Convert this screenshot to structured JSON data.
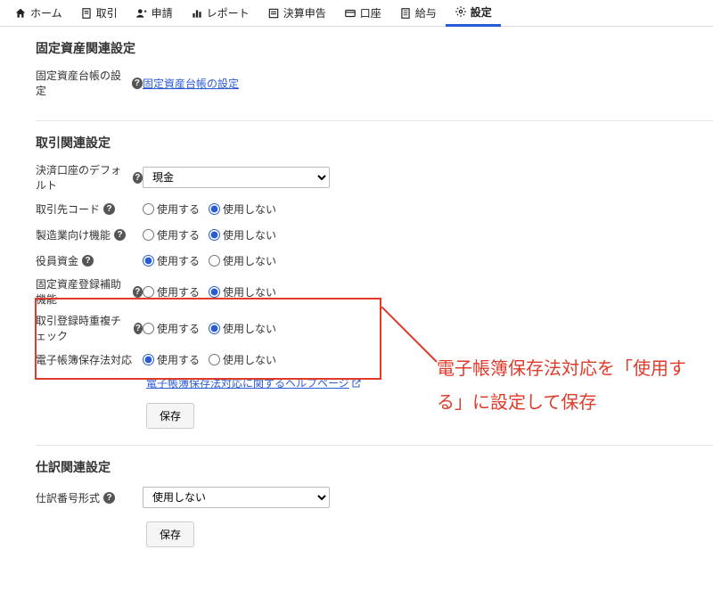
{
  "nav": {
    "items": [
      {
        "label": "ホーム",
        "icon": "home"
      },
      {
        "label": "取引",
        "icon": "doc"
      },
      {
        "label": "申請",
        "icon": "person"
      },
      {
        "label": "レポート",
        "icon": "bar"
      },
      {
        "label": "決算申告",
        "icon": "list"
      },
      {
        "label": "口座",
        "icon": "card"
      },
      {
        "label": "給与",
        "icon": "sheet"
      },
      {
        "label": "設定",
        "icon": "gear",
        "active": true
      }
    ]
  },
  "sections": {
    "fixed_asset": {
      "title": "固定資産関連設定",
      "row_label": "固定資産台帳の設定",
      "link": "固定資産台帳の設定"
    },
    "transaction": {
      "title": "取引関連設定",
      "default_account": {
        "label": "決済口座のデフォルト",
        "value": "現金"
      },
      "rows": [
        {
          "label": "取引先コード",
          "selected": "use_no"
        },
        {
          "label": "製造業向け機能",
          "selected": "use_no"
        },
        {
          "label": "役員資金",
          "selected": "use_yes"
        },
        {
          "label": "固定資産登録補助機能",
          "selected": "use_no"
        },
        {
          "label": "取引登録時重複チェック",
          "selected": "use_no"
        },
        {
          "label": "電子帳簿保存法対応",
          "selected": "use_yes"
        }
      ],
      "radio_labels": {
        "use_yes": "使用する",
        "use_no": "使用しない"
      },
      "help_link": "電子帳簿保存法対応に関するヘルプページ",
      "save": "保存"
    },
    "journal": {
      "title": "仕訳関連設定",
      "row_label": "仕訳番号形式",
      "select_value": "使用しない",
      "save": "保存"
    }
  },
  "callout": "電子帳簿保存法対応を「使用する」に設定して保存",
  "help_glyph": "?"
}
